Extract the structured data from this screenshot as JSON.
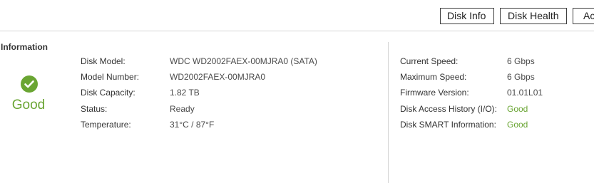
{
  "toolbar": {
    "disk_info": "Disk Info",
    "disk_health": "Disk Health",
    "action": "Ac"
  },
  "section": {
    "title": "k Information"
  },
  "status": {
    "word": "Good",
    "icon": "check-circle-icon",
    "color": "#6aa533"
  },
  "left_rows": [
    {
      "label": "Disk Model:",
      "value": "WDC WD2002FAEX-00MJRA0 (SATA)"
    },
    {
      "label": "Model Number:",
      "value": "WD2002FAEX-00MJRA0"
    },
    {
      "label": "Disk Capacity:",
      "value": "1.82 TB"
    },
    {
      "label": "Status:",
      "value": "Ready"
    },
    {
      "label": "Temperature:",
      "value": "31°C / 87°F"
    }
  ],
  "right_rows": [
    {
      "label": "Current Speed:",
      "value": "6 Gbps"
    },
    {
      "label": "Maximum Speed:",
      "value": "6 Gbps"
    },
    {
      "label": "Firmware Version:",
      "value": "01.01L01"
    },
    {
      "label": "Disk Access History (I/O):",
      "value": "Good"
    },
    {
      "label": "Disk SMART Information:",
      "value": "Good"
    }
  ]
}
